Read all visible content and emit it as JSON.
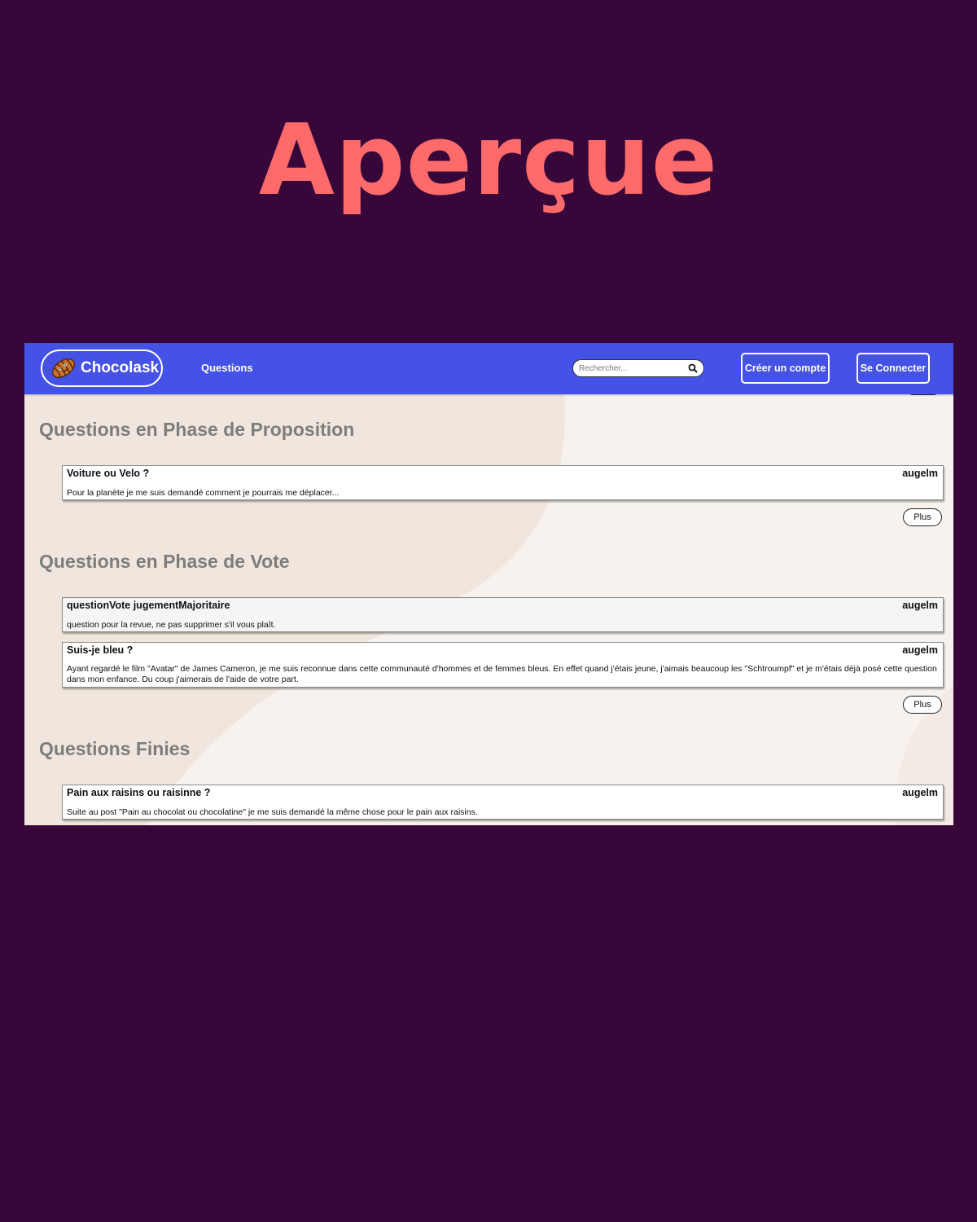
{
  "poster": {
    "title": "Aperçue"
  },
  "navbar": {
    "brand": "Chocolask",
    "questions_link": "Questions",
    "search_placeholder": "Rechercher...",
    "register_button": "Créer un compte",
    "login_button": "Se Connecter"
  },
  "sections": [
    {
      "title": "Questions en Phase de Proposition",
      "questions": [
        {
          "title": "Voiture ou Velo ?",
          "author": "augelm",
          "body": "Pour la planète je me suis demandé comment je pourrais me déplacer..."
        }
      ],
      "more_button": "Plus"
    },
    {
      "title": "Questions en Phase de Vote",
      "questions": [
        {
          "title": "questionVote jugementMajoritaire",
          "author": "augelm",
          "body": "question pour la revue, ne pas supprimer s'il vous plaît."
        },
        {
          "title": "Suis-je bleu ?",
          "author": "augelm",
          "body": "Ayant regardé le film \"Avatar\" de James Cameron, je me suis reconnue dans cette communauté d'hommes et de femmes bleus. En effet quand j'étais jeune, j'aimais beaucoup les \"Schtroumpf\" et je m'étais déjà posé cette question dans mon enfance. Du coup j'aimerais de l'aide de votre part."
        }
      ],
      "more_button": "Plus"
    },
    {
      "title": "Questions Finies",
      "questions": [
        {
          "title": "Pain aux raisins ou raisinne ?",
          "author": "augelm",
          "body": "Suite au post \"Pain au chocolat ou chocolatine\" je me suis demandé la même chose pour le pain aux raisins."
        }
      ]
    }
  ],
  "colors": {
    "poster_background": "#38073a",
    "poster_title": "#ff6b6b",
    "navbar": "#4452e6",
    "page_background": "#f7f2ee",
    "blob": "#f0e6dd",
    "section_title": "#7d7d7d"
  },
  "icons": {
    "logo": "chocolatine-logo-icon",
    "search": "search-icon"
  }
}
